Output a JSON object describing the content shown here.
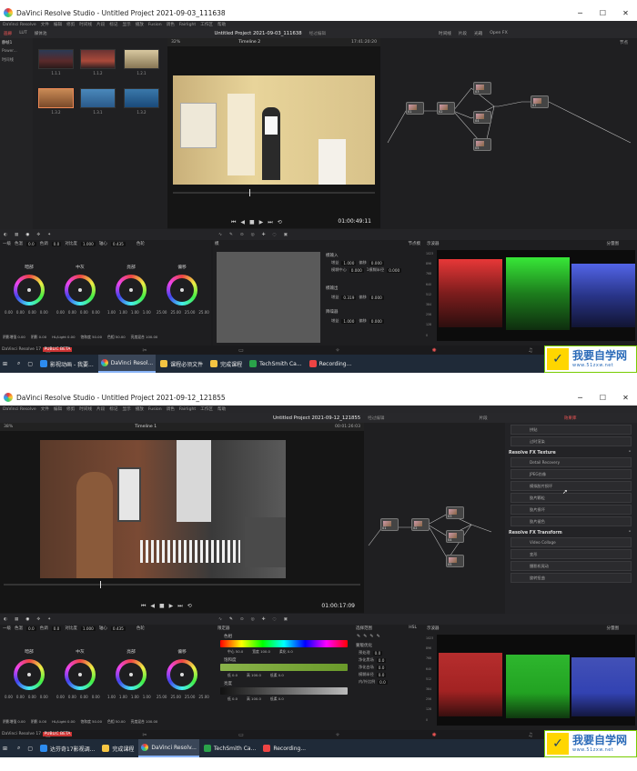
{
  "shots": [
    {
      "window_title": "DaVinci Resolve Studio - Untitled Project 2021-09-03_111638",
      "menu": [
        "DaVinci Resolve",
        "文件",
        "编辑",
        "修剪",
        "时间线",
        "片段",
        "标记",
        "显示",
        "播放",
        "Fusion",
        "调色",
        "Fairlight",
        "工作区",
        "帮助"
      ],
      "project_title": "Untitled Project 2021-09-03_111638",
      "project_status": "经过编辑",
      "top_tabs": [
        "画廊",
        "LUT",
        "媒体池"
      ],
      "top_right": [
        "时间线",
        "片段",
        "光箱",
        "Open FX"
      ],
      "viewer": {
        "zoom": "32%",
        "timeline": "Timeline 2",
        "timecode_top": "17:41:20:20",
        "timecode": "01:00:49:11"
      },
      "nodes_label": "节点",
      "gallery": [
        "静帧1",
        "Power...",
        "时间线"
      ],
      "clips": [
        "1.1.1",
        "1.1.2",
        "1.2.1",
        "1.3.2",
        "1.3.1",
        "1.3.2"
      ],
      "primaries": {
        "mode": "一级",
        "contrast_label": "色温",
        "contrast_val": "0.0",
        "tint_label": "色调",
        "tint_val": "0.0",
        "pivot_label": "对比度",
        "pivot_val": "1.000",
        "piv_label": "轴心",
        "piv_val": "0.435",
        "mode_right": "色轮"
      },
      "wheels": [
        {
          "label": "暗部",
          "vals": [
            "0.00",
            "0.00",
            "0.00",
            "0.00"
          ]
        },
        {
          "label": "中灰",
          "vals": [
            "0.00",
            "0.00",
            "0.00",
            "0.00"
          ]
        },
        {
          "label": "亮部",
          "vals": [
            "1.00",
            "1.00",
            "1.00",
            "1.00"
          ]
        },
        {
          "label": "偏移",
          "vals": [
            "25.00",
            "25.00",
            "25.00",
            "25.00"
          ]
        }
      ],
      "bottom_params": [
        "阴影增强 0.00",
        "阴影 0.00",
        "HL/Light 0.00",
        "饱和度 50.00",
        "色相 50.00",
        "亮度混合 100.00"
      ],
      "middle_title": "模",
      "middle_fields": [
        {
          "label": "增益",
          "val": "1.000"
        },
        {
          "label": "偏移",
          "val": "0.000"
        },
        {
          "label": "模糊中心",
          "val": "0.000"
        },
        {
          "label": "1模糊半径",
          "val": "0.000"
        },
        {
          "label": "增益",
          "val": "0.319"
        },
        {
          "label": "偏移",
          "val": "0.000"
        },
        {
          "label": "增益",
          "val": "1.000"
        },
        {
          "label": "偏移",
          "val": "0.000"
        }
      ],
      "middle_headers": [
        "模输入",
        "模输出",
        "降噪器"
      ],
      "scope_title": "示波器",
      "scope_mode": "分量图",
      "scope_ticks": [
        "1023",
        "896",
        "768",
        "640",
        "512",
        "384",
        "256",
        "128",
        "0"
      ],
      "scope_extra": "节点模",
      "taskbar": [
        "影视动画 - 我要...",
        "DaVinci Resol...",
        "课程必须文件",
        "完成课程",
        "TechSmith Ca...",
        "Recording..."
      ],
      "watermark": {
        "big": "我要自学网",
        "url": "www.51zxw.net"
      },
      "beta": "PUBLIC BETA",
      "app": "DaVinci Resolve 17"
    },
    {
      "window_title": "DaVinci Resolve Studio - Untitled Project 2021-09-12_121855",
      "menu": [
        "DaVinci Resolve",
        "文件",
        "编辑",
        "修剪",
        "时间线",
        "片段",
        "标记",
        "显示",
        "播放",
        "Fusion",
        "调色",
        "Fairlight",
        "工作区",
        "帮助"
      ],
      "project_title": "Untitled Project 2021-09-12_121855",
      "project_status": "经过编辑",
      "viewer": {
        "zoom": "38%",
        "timeline": "Timeline 1",
        "timecode_top": "00:01:26:03",
        "timecode": "01:00:17:09"
      },
      "top_right": [
        "片段",
        "效果库"
      ],
      "fx_top": [
        "拼贴",
        "过时渲染"
      ],
      "fx_texture_title": "Resolve FX Texture",
      "fx_texture": [
        "Detail Recovery",
        "JPEG伪像",
        "模拟胶片损坏",
        "胶片颗粒",
        "胶片损坏",
        "胶片褪色"
      ],
      "fx_transform_title": "Resolve FX Transform",
      "fx_transform": [
        "Video Collage",
        "变形",
        "摄影机晃动",
        "旋转扭曲"
      ],
      "primaries": {
        "mode": "一级",
        "contrast_label": "色温",
        "contrast_val": "0.0",
        "tint_label": "色调",
        "tint_val": "0.0",
        "pivot_label": "对比度",
        "pivot_val": "1.000",
        "piv_label": "轴心",
        "piv_val": "0.435",
        "mode_right": "色轮"
      },
      "wheels": [
        {
          "label": "暗部",
          "vals": [
            "0.00",
            "0.00",
            "0.00",
            "0.00"
          ]
        },
        {
          "label": "中灰",
          "vals": [
            "0.00",
            "0.00",
            "0.00",
            "0.00"
          ]
        },
        {
          "label": "亮部",
          "vals": [
            "1.00",
            "1.00",
            "1.00",
            "1.00"
          ]
        },
        {
          "label": "偏移",
          "vals": [
            "25.00",
            "25.00",
            "25.00",
            "25.00"
          ]
        }
      ],
      "bottom_params": [
        "阴影增强 0.00",
        "阴影 0.00",
        "HL/Light 0.00",
        "饱和度 50.00",
        "色相 50.00",
        "亮度混合 100.00"
      ],
      "hsl_title": "限定器",
      "hsl_rows": [
        {
          "label": "色相",
          "left": "中心 50.0",
          "mid": "宽度 100.0",
          "right": "柔化 0.0"
        },
        {
          "label": "饱和度",
          "left": "低 0.0",
          "mid": "高 100.0",
          "right": "低柔 0.0"
        },
        {
          "label": "亮度",
          "left": "低 0.0",
          "mid": "高 100.0",
          "right": "低柔 0.0"
        }
      ],
      "sel_title": "选择范围",
      "sel_mode": "HSL",
      "refine_title": "蒙版优化",
      "refine": [
        {
          "label": "预处理",
          "val": "0.0"
        },
        {
          "label": "净化黑场",
          "val": "0.0"
        },
        {
          "label": "净化白场",
          "val": "0.0"
        },
        {
          "label": "模糊半径",
          "val": "0.0"
        },
        {
          "label": "内/外比例",
          "val": "0.0"
        }
      ],
      "scope_title": "示波器",
      "scope_mode": "分量图",
      "scope_ticks": [
        "1023",
        "896",
        "768",
        "640",
        "512",
        "384",
        "256",
        "128",
        "0"
      ],
      "taskbar": [
        "达芬奇17影视调...",
        "完成课程",
        "DaVinci Resolv...",
        "TechSmith Ca...",
        "Recording..."
      ],
      "watermark": {
        "big": "我要自学网",
        "url": "www.51zxw.net"
      },
      "beta": "PUBLIC BETA",
      "app": "DaVinci Resolve 17"
    }
  ]
}
